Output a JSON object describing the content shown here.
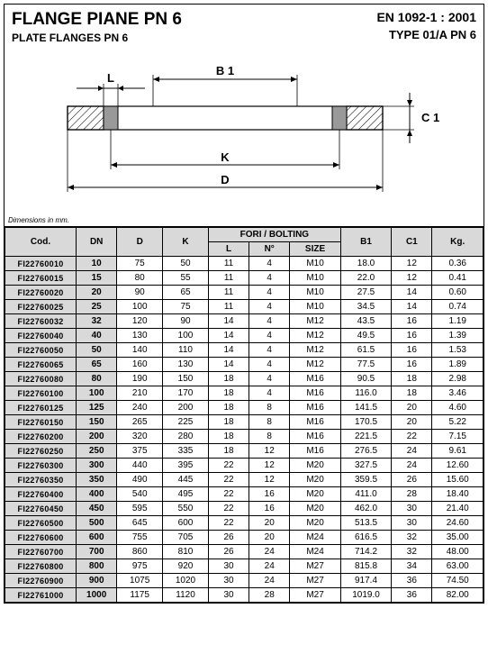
{
  "header": {
    "title_it": "FLANGE PIANE PN 6",
    "title_en": "PLATE FLANGES PN 6",
    "standard": "EN 1092-1 : 2001",
    "type": "TYPE 01/A PN 6"
  },
  "diagram": {
    "labels": {
      "L": "L",
      "B1": "B 1",
      "C1": "C 1",
      "K": "K",
      "D": "D"
    },
    "note": "Dimensions in mm."
  },
  "table": {
    "headers": {
      "cod": "Cod.",
      "dn": "DN",
      "d": "D",
      "k": "K",
      "grp": "FORI / BOLTING",
      "l": "L",
      "n": "N°",
      "size": "SIZE",
      "b1": "B1",
      "c1": "C1",
      "kg": "Kg."
    },
    "rows": [
      {
        "cod": "FI22760010",
        "dn": "10",
        "d": "75",
        "k": "50",
        "l": "11",
        "n": "4",
        "size": "M10",
        "b1": "18.0",
        "c1": "12",
        "kg": "0.36"
      },
      {
        "cod": "FI22760015",
        "dn": "15",
        "d": "80",
        "k": "55",
        "l": "11",
        "n": "4",
        "size": "M10",
        "b1": "22.0",
        "c1": "12",
        "kg": "0.41"
      },
      {
        "cod": "FI22760020",
        "dn": "20",
        "d": "90",
        "k": "65",
        "l": "11",
        "n": "4",
        "size": "M10",
        "b1": "27.5",
        "c1": "14",
        "kg": "0.60"
      },
      {
        "cod": "FI22760025",
        "dn": "25",
        "d": "100",
        "k": "75",
        "l": "11",
        "n": "4",
        "size": "M10",
        "b1": "34.5",
        "c1": "14",
        "kg": "0.74"
      },
      {
        "cod": "FI22760032",
        "dn": "32",
        "d": "120",
        "k": "90",
        "l": "14",
        "n": "4",
        "size": "M12",
        "b1": "43.5",
        "c1": "16",
        "kg": "1.19"
      },
      {
        "cod": "FI22760040",
        "dn": "40",
        "d": "130",
        "k": "100",
        "l": "14",
        "n": "4",
        "size": "M12",
        "b1": "49.5",
        "c1": "16",
        "kg": "1.39"
      },
      {
        "cod": "FI22760050",
        "dn": "50",
        "d": "140",
        "k": "110",
        "l": "14",
        "n": "4",
        "size": "M12",
        "b1": "61.5",
        "c1": "16",
        "kg": "1.53"
      },
      {
        "cod": "FI22760065",
        "dn": "65",
        "d": "160",
        "k": "130",
        "l": "14",
        "n": "4",
        "size": "M12",
        "b1": "77.5",
        "c1": "16",
        "kg": "1.89"
      },
      {
        "cod": "FI22760080",
        "dn": "80",
        "d": "190",
        "k": "150",
        "l": "18",
        "n": "4",
        "size": "M16",
        "b1": "90.5",
        "c1": "18",
        "kg": "2.98"
      },
      {
        "cod": "FI22760100",
        "dn": "100",
        "d": "210",
        "k": "170",
        "l": "18",
        "n": "4",
        "size": "M16",
        "b1": "116.0",
        "c1": "18",
        "kg": "3.46"
      },
      {
        "cod": "FI22760125",
        "dn": "125",
        "d": "240",
        "k": "200",
        "l": "18",
        "n": "8",
        "size": "M16",
        "b1": "141.5",
        "c1": "20",
        "kg": "4.60"
      },
      {
        "cod": "FI22760150",
        "dn": "150",
        "d": "265",
        "k": "225",
        "l": "18",
        "n": "8",
        "size": "M16",
        "b1": "170.5",
        "c1": "20",
        "kg": "5.22"
      },
      {
        "cod": "FI22760200",
        "dn": "200",
        "d": "320",
        "k": "280",
        "l": "18",
        "n": "8",
        "size": "M16",
        "b1": "221.5",
        "c1": "22",
        "kg": "7.15"
      },
      {
        "cod": "FI22760250",
        "dn": "250",
        "d": "375",
        "k": "335",
        "l": "18",
        "n": "12",
        "size": "M16",
        "b1": "276.5",
        "c1": "24",
        "kg": "9.61"
      },
      {
        "cod": "FI22760300",
        "dn": "300",
        "d": "440",
        "k": "395",
        "l": "22",
        "n": "12",
        "size": "M20",
        "b1": "327.5",
        "c1": "24",
        "kg": "12.60"
      },
      {
        "cod": "FI22760350",
        "dn": "350",
        "d": "490",
        "k": "445",
        "l": "22",
        "n": "12",
        "size": "M20",
        "b1": "359.5",
        "c1": "26",
        "kg": "15.60"
      },
      {
        "cod": "FI22760400",
        "dn": "400",
        "d": "540",
        "k": "495",
        "l": "22",
        "n": "16",
        "size": "M20",
        "b1": "411.0",
        "c1": "28",
        "kg": "18.40"
      },
      {
        "cod": "FI22760450",
        "dn": "450",
        "d": "595",
        "k": "550",
        "l": "22",
        "n": "16",
        "size": "M20",
        "b1": "462.0",
        "c1": "30",
        "kg": "21.40"
      },
      {
        "cod": "FI22760500",
        "dn": "500",
        "d": "645",
        "k": "600",
        "l": "22",
        "n": "20",
        "size": "M20",
        "b1": "513.5",
        "c1": "30",
        "kg": "24.60"
      },
      {
        "cod": "FI22760600",
        "dn": "600",
        "d": "755",
        "k": "705",
        "l": "26",
        "n": "20",
        "size": "M24",
        "b1": "616.5",
        "c1": "32",
        "kg": "35.00"
      },
      {
        "cod": "FI22760700",
        "dn": "700",
        "d": "860",
        "k": "810",
        "l": "26",
        "n": "24",
        "size": "M24",
        "b1": "714.2",
        "c1": "32",
        "kg": "48.00"
      },
      {
        "cod": "FI22760800",
        "dn": "800",
        "d": "975",
        "k": "920",
        "l": "30",
        "n": "24",
        "size": "M27",
        "b1": "815.8",
        "c1": "34",
        "kg": "63.00"
      },
      {
        "cod": "FI22760900",
        "dn": "900",
        "d": "1075",
        "k": "1020",
        "l": "30",
        "n": "24",
        "size": "M27",
        "b1": "917.4",
        "c1": "36",
        "kg": "74.50"
      },
      {
        "cod": "FI22761000",
        "dn": "1000",
        "d": "1175",
        "k": "1120",
        "l": "30",
        "n": "28",
        "size": "M27",
        "b1": "1019.0",
        "c1": "36",
        "kg": "82.00"
      }
    ]
  }
}
